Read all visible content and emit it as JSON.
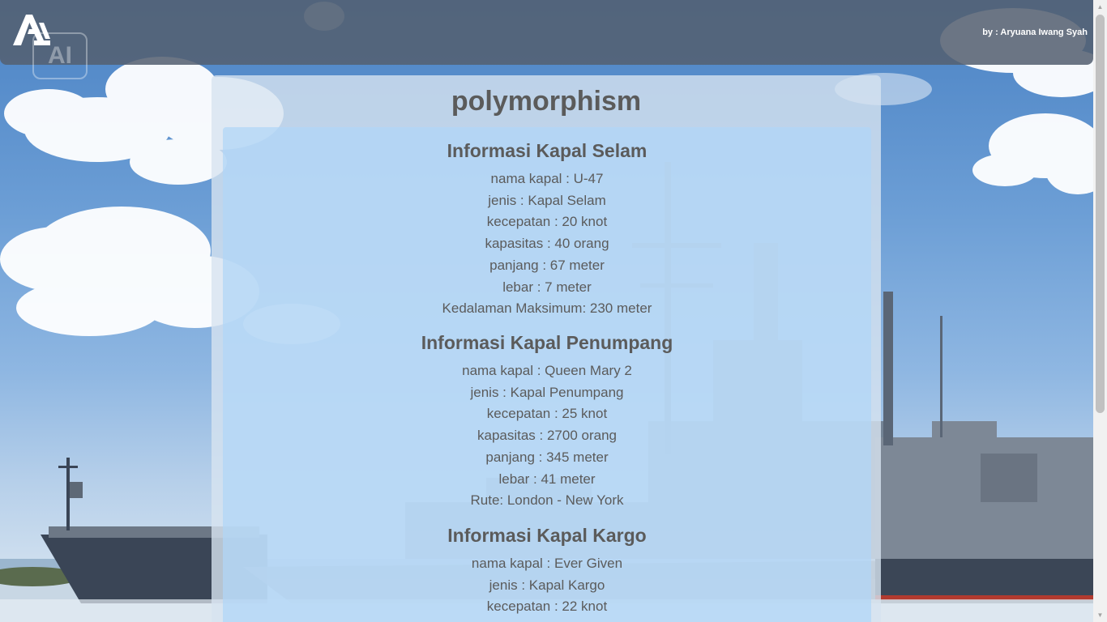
{
  "header": {
    "byline": "by : Aryuana Iwang Syah",
    "watermark": "AI",
    "logo_icon": "aa-logo-icon"
  },
  "main": {
    "title": "polymorphism",
    "sections": [
      {
        "heading": "Informasi Kapal Selam",
        "lines": [
          "nama kapal : U-47",
          "jenis : Kapal Selam",
          "kecepatan : 20 knot",
          "kapasitas : 40 orang",
          "panjang : 67 meter",
          "lebar : 7 meter",
          "Kedalaman Maksimum: 230 meter"
        ]
      },
      {
        "heading": "Informasi Kapal Penumpang",
        "lines": [
          "nama kapal : Queen Mary 2",
          "jenis : Kapal Penumpang",
          "kecepatan : 25 knot",
          "kapasitas : 2700 orang",
          "panjang : 345 meter",
          "lebar : 41 meter",
          "Rute: London - New York"
        ]
      },
      {
        "heading": "Informasi Kapal Kargo",
        "lines": [
          "nama kapal : Ever Given",
          "jenis : Kapal Kargo",
          "kecepatan : 22 knot"
        ]
      }
    ]
  },
  "colors": {
    "header_bg": "#546070",
    "text": "#5b5b5b",
    "card_bg": "#d7e4f0",
    "inner_bg": "#b0d6f7"
  }
}
